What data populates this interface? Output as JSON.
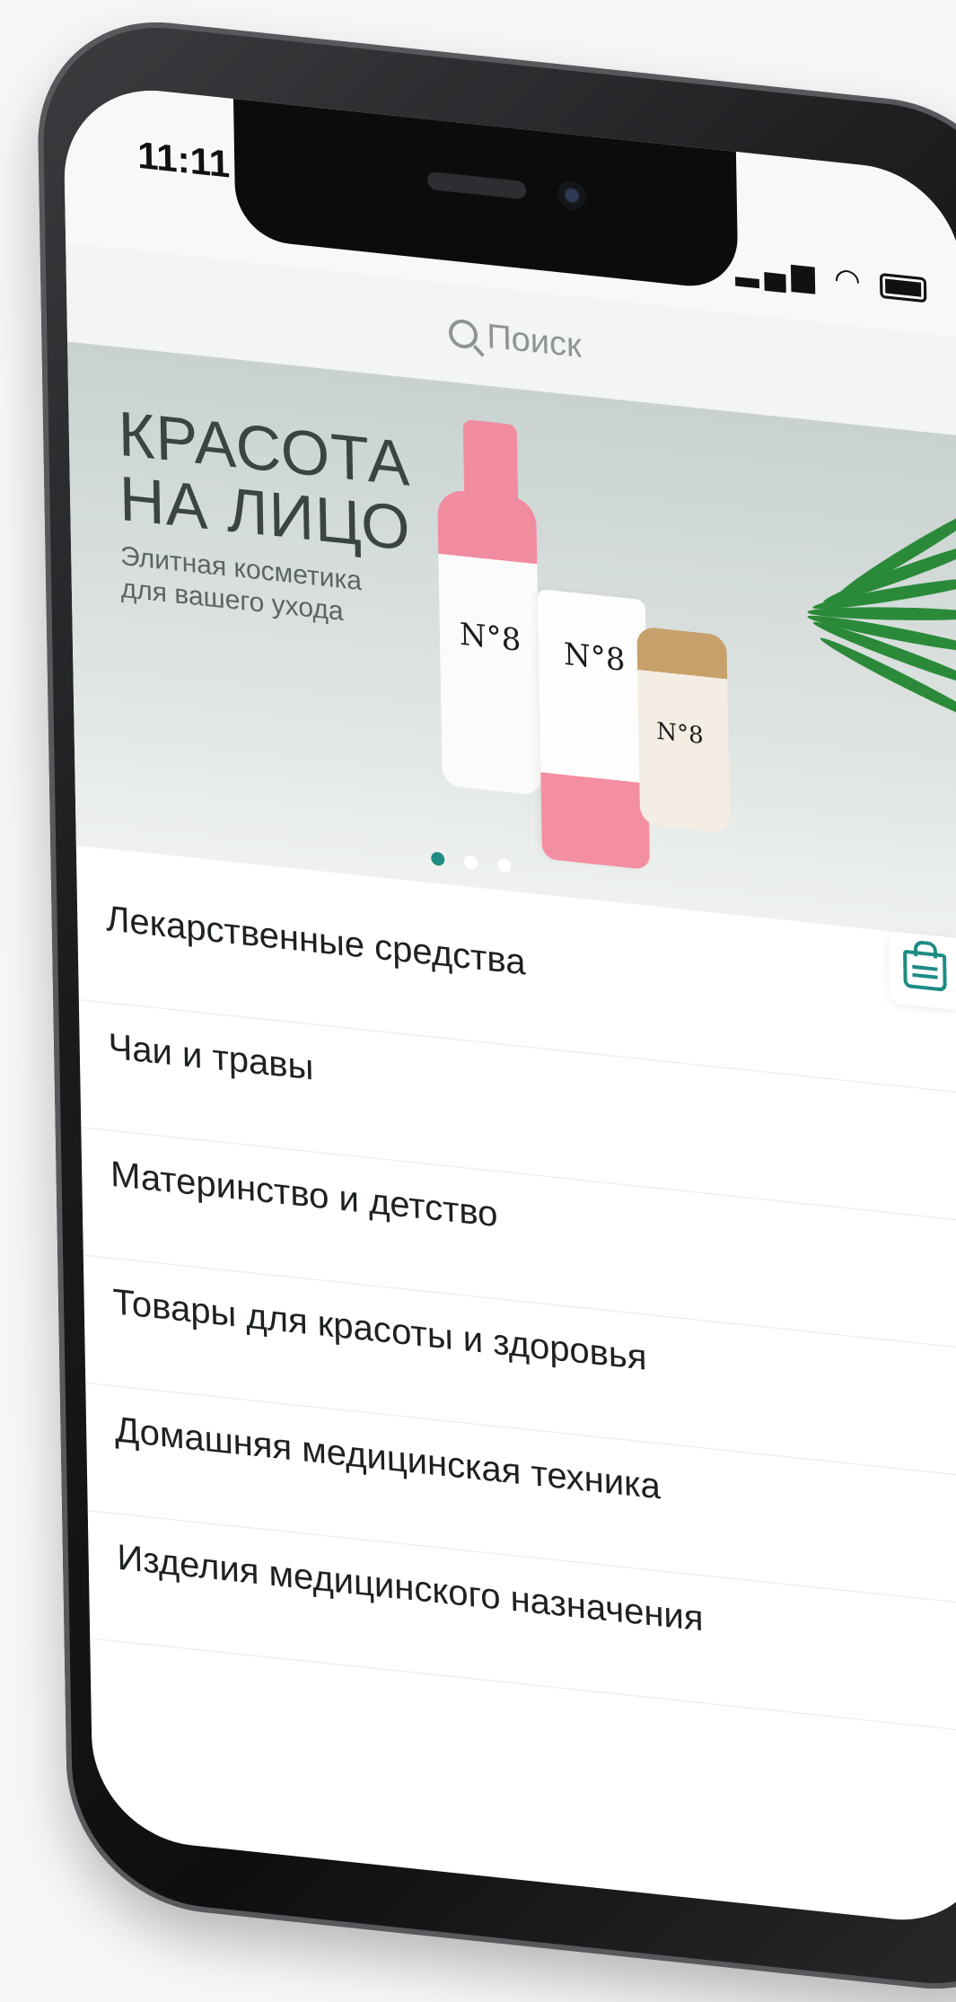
{
  "status": {
    "time": "11:11",
    "signal": "▂▄▆",
    "wifi": "◠"
  },
  "search": {
    "placeholder": "Поиск"
  },
  "banner": {
    "title_line1": "КРАСОТА",
    "title_line2": "НА ЛИЦО",
    "subtitle_line1": "Элитная косметика",
    "subtitle_line2": "для вашего ухода",
    "product_label": "N°8",
    "slides_total": 3,
    "active_slide": 1,
    "accent_color": "#1e8b85"
  },
  "categories": [
    {
      "label": "Лекарственные средства"
    },
    {
      "label": "Чаи и травы"
    },
    {
      "label": "Материнство и детство"
    },
    {
      "label": "Товары для красоты и здоровья"
    },
    {
      "label": "Домашняя медицинская техника"
    },
    {
      "label": "Изделия медицинского назначения"
    }
  ],
  "icons": {
    "search": "search-icon",
    "cart": "shopping-bag-icon"
  }
}
